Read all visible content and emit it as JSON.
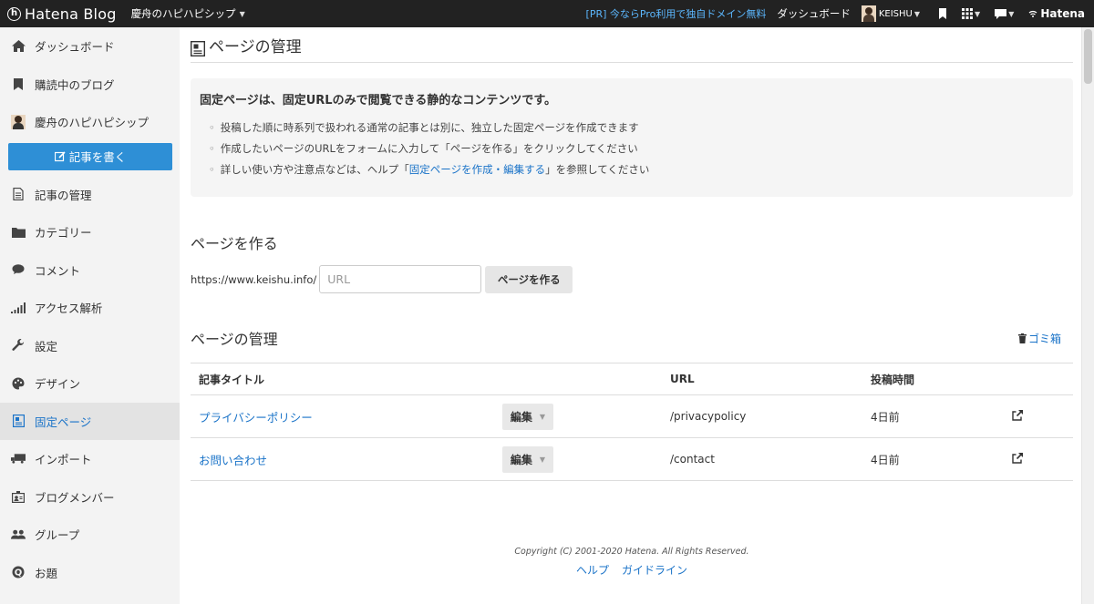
{
  "topbar": {
    "logo_mark": "h",
    "logo_text": "Hatena Blog",
    "blog_name": "慶舟のハピハピシップ",
    "pr_link": "[PR] 今ならPro利用で独自ドメイン無料",
    "dashboard_link": "ダッシュボード",
    "username": "KEISHU",
    "hatena": "Hatena"
  },
  "sidebar": {
    "items": [
      {
        "label": "ダッシュボード",
        "icon": "home-icon"
      },
      {
        "label": "購読中のブログ",
        "icon": "bookmark-icon"
      },
      {
        "label": "慶舟のハピハピシップ",
        "icon": "avatar"
      },
      {
        "label": "記事の管理",
        "icon": "document-icon"
      },
      {
        "label": "カテゴリー",
        "icon": "folder-icon"
      },
      {
        "label": "コメント",
        "icon": "comment-icon"
      },
      {
        "label": "アクセス解析",
        "icon": "signal-icon"
      },
      {
        "label": "設定",
        "icon": "wrench-icon"
      },
      {
        "label": "デザイン",
        "icon": "palette-icon"
      },
      {
        "label": "固定ページ",
        "icon": "page-icon"
      },
      {
        "label": "インポート",
        "icon": "truck-icon"
      },
      {
        "label": "ブログメンバー",
        "icon": "member-icon"
      },
      {
        "label": "グループ",
        "icon": "group-icon"
      },
      {
        "label": "お題",
        "icon": "question-icon"
      }
    ],
    "write_button": "記事を書く"
  },
  "main": {
    "page_title": "ページの管理",
    "info": {
      "heading": "固定ページは、固定URLのみで閲覧できる静的なコンテンツです。",
      "bullet1": "投稿した順に時系列で扱われる通常の記事とは別に、独立した固定ページを作成できます",
      "bullet2": "作成したいページのURLをフォームに入力して「ページを作る」をクリックしてください",
      "bullet3_prefix": "詳しい使い方や注意点などは、ヘルプ「",
      "bullet3_link": "固定ページを作成・編集する",
      "bullet3_suffix": "」を参照してください"
    },
    "create": {
      "title": "ページを作る",
      "url_prefix": "https://www.keishu.info/",
      "url_placeholder": "URL",
      "button": "ページを作る"
    },
    "manage": {
      "title": "ページの管理",
      "trash_link": "ゴミ箱",
      "columns": [
        "記事タイトル",
        "",
        "URL",
        "投稿時間",
        ""
      ],
      "rows": [
        {
          "title": "プライバシーポリシー",
          "edit": "編集",
          "url": "/privacypolicy",
          "time": "4日前"
        },
        {
          "title": "お問い合わせ",
          "edit": "編集",
          "url": "/contact",
          "time": "4日前"
        }
      ]
    }
  },
  "footer": {
    "copyright": "Copyright (C) 2001-2020 Hatena. All Rights Reserved.",
    "help": "ヘルプ",
    "guideline": "ガイドライン"
  }
}
